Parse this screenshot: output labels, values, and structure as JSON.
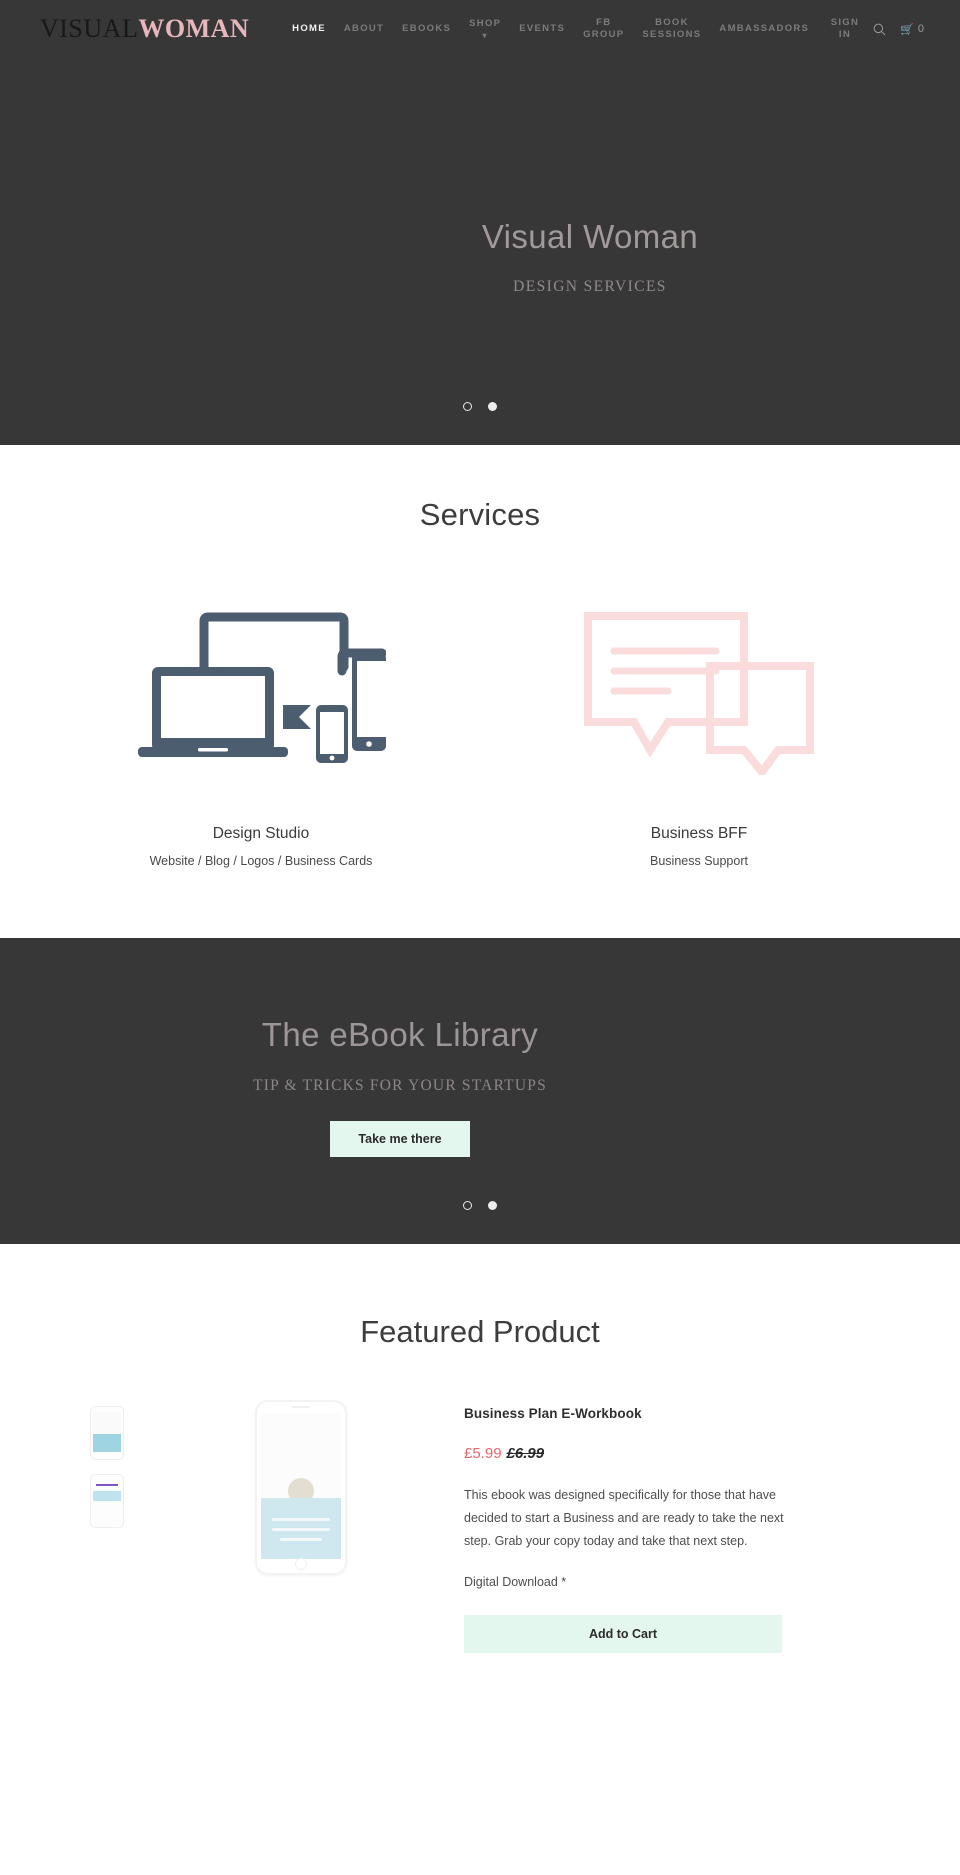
{
  "header": {
    "logo_part1": "VISUAL",
    "logo_part2": "WOMAN",
    "nav": [
      {
        "label": "HOME",
        "active": true,
        "caret": false
      },
      {
        "label": "ABOUT",
        "active": false,
        "caret": false
      },
      {
        "label": "EBOOKS",
        "active": false,
        "caret": false
      },
      {
        "label": "SHOP",
        "active": false,
        "caret": true
      },
      {
        "label": "EVENTS",
        "active": false,
        "caret": false
      },
      {
        "label": "FB\nGROUP",
        "active": false,
        "caret": false
      },
      {
        "label": "BOOK\nSESSIONS",
        "active": false,
        "caret": false
      },
      {
        "label": "AMBASSADORS",
        "active": false,
        "caret": false
      }
    ],
    "sign_in": "SIGN\nIN",
    "search_icon": "search-icon",
    "cart_icon": "cart-icon",
    "cart_count": "0"
  },
  "hero": {
    "title": "Visual Woman",
    "subtitle": "DESIGN SERVICES",
    "dots": [
      "hollow",
      "filled"
    ]
  },
  "services": {
    "title": "Services",
    "items": [
      {
        "icon": "devices-icon",
        "name": "Design Studio",
        "desc": "Website / Blog / Logos / Business Cards",
        "color": "#4c5d70"
      },
      {
        "icon": "speech-bubbles-icon",
        "name": "Business BFF",
        "desc": "Business Support",
        "color": "#fadcdc"
      }
    ]
  },
  "ebook": {
    "title": "The eBook Library",
    "subtitle": "TIP & TRICKS FOR YOUR STARTUPS",
    "button": "Take me there",
    "dots": [
      "hollow",
      "filled"
    ]
  },
  "featured": {
    "title": "Featured Product",
    "product_name": "Business Plan E-Workbook",
    "price_now": "£5.99",
    "price_was": "£6.99",
    "description": "This ebook was designed specifically for those that have decided to start a Business and are ready to take the next step. Grab your copy today and take that next step.",
    "note": "Digital Download *",
    "add_to_cart": "Add to Cart",
    "thumbnails": [
      "thumbnail-beach",
      "thumbnail-card"
    ]
  },
  "colors": {
    "dark_band": "#373737",
    "accent_pink": "#e8b6bd",
    "mint_button": "#e4f7ef",
    "price_red": "#e2696e",
    "devices_slate": "#4c5d70",
    "bubbles_pink": "#fadcdc"
  }
}
